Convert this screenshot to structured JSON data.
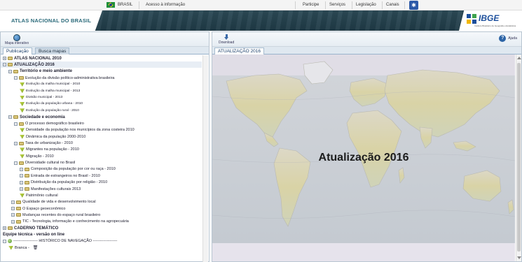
{
  "govbar": {
    "brasil": "BRASIL",
    "acesso": "Acesso à informação",
    "links": [
      "Participe",
      "Serviços",
      "Legislação",
      "Canais"
    ]
  },
  "header": {
    "title": "ATLAS NACIONAL DO BRASIL",
    "logo": "IBGE",
    "logo_sub": "Instituto Brasileiro de Geografia e Estatística"
  },
  "left": {
    "tool_label": "Mapa interativo",
    "tabs": [
      "Publicação",
      "Busca mapas"
    ]
  },
  "tree": [
    {
      "label": "ATLAS NACIONAL 2010",
      "level": 0,
      "bold": true,
      "icon": "folder",
      "exp": "+"
    },
    {
      "label": "ATUALIZAÇÃO 2016",
      "level": 0,
      "bold": true,
      "icon": "folder",
      "exp": "-",
      "selected": true
    },
    {
      "label": "Território e meio ambiente",
      "level": 1,
      "bold": true,
      "icon": "folder",
      "exp": "-"
    },
    {
      "label": "Evolução da divisão político-administrativa brasileira",
      "level": 2,
      "icon": "folder",
      "exp": "-"
    },
    {
      "label": "Evolução da malha municipal - 2010",
      "level": 3,
      "icon": "leaf",
      "small": true
    },
    {
      "label": "Evolução da malha municipal - 2013",
      "level": 3,
      "icon": "leaf",
      "small": true
    },
    {
      "label": "Divisão municipal - 2013",
      "level": 3,
      "icon": "leaf",
      "small": true
    },
    {
      "label": "Evolução da população urbana - 2010",
      "level": 3,
      "icon": "leaf",
      "small": true
    },
    {
      "label": "Evolução da população rural - 2010",
      "level": 3,
      "icon": "leaf",
      "small": true
    },
    {
      "label": "Sociedade e economia",
      "level": 1,
      "bold": true,
      "icon": "folder",
      "exp": "-"
    },
    {
      "label": "O processo demográfico brasileiro",
      "level": 2,
      "icon": "folder",
      "exp": "-"
    },
    {
      "label": "Densidade da população nos municípios da zona costeira 2010",
      "level": 3,
      "icon": "leaf"
    },
    {
      "label": "Dinâmica da população 2000-2010",
      "level": 3,
      "icon": "leaf"
    },
    {
      "label": "Taxa de urbanização - 2010",
      "level": 2,
      "icon": "folder",
      "exp": "+"
    },
    {
      "label": "Migrantes na população - 2010",
      "level": 3,
      "icon": "leaf"
    },
    {
      "label": "Migração - 2010",
      "level": 3,
      "icon": "leaf"
    },
    {
      "label": "Diversidade cultural no Brasil",
      "level": 2,
      "icon": "folder",
      "exp": "-"
    },
    {
      "label": "Composição da população por cor ou raça - 2010",
      "level": 2,
      "icon": "folder",
      "exp": "+",
      "indent": 1
    },
    {
      "label": "Entrada de estrangeiros no Brasil - 2010",
      "level": 2,
      "icon": "folder",
      "exp": "+",
      "indent": 1
    },
    {
      "label": "Distribuição da população por religião - 2010",
      "level": 2,
      "icon": "folder",
      "exp": "+",
      "indent": 1
    },
    {
      "label": "Manifestações culturais 2013",
      "level": 2,
      "icon": "folder",
      "exp": "+",
      "indent": 1
    },
    {
      "label": "Patrimônio cultural",
      "level": 3,
      "icon": "leaf"
    },
    {
      "label": "Qualidade de vida e desenvolvimento local",
      "level": 1.5,
      "icon": "folder",
      "exp": "+"
    },
    {
      "label": "O Espaço geoeconômico",
      "level": 1.5,
      "icon": "folder",
      "exp": "+"
    },
    {
      "label": "Mudanças recentes do espaço rural brasileiro",
      "level": 1.5,
      "icon": "folder",
      "exp": "+"
    },
    {
      "label": "TIC - Tecnologia, informação e conhecimento na agropecuária",
      "level": 1.5,
      "icon": "folder",
      "exp": "+"
    },
    {
      "label": "CADERNO TEMÁTICO",
      "level": 0,
      "bold": true,
      "icon": "folder",
      "exp": "+"
    },
    {
      "label": "Equipe técnica - versão on line",
      "level": 0,
      "bold": true,
      "icon": "none",
      "exp": ""
    },
    {
      "label": "------------------- HISTÓRICO DE NAVEGAÇÃO -------------------",
      "level": 0,
      "icon": "circle",
      "exp": "-"
    },
    {
      "label": "Branca  -",
      "level": 1,
      "icon": "leaf",
      "trash": true
    }
  ],
  "right": {
    "download_label": "Download",
    "help_label": "Ajuda",
    "tab": "ATUALIZAÇÃO 2016",
    "map_title": "Atualização 2016"
  }
}
